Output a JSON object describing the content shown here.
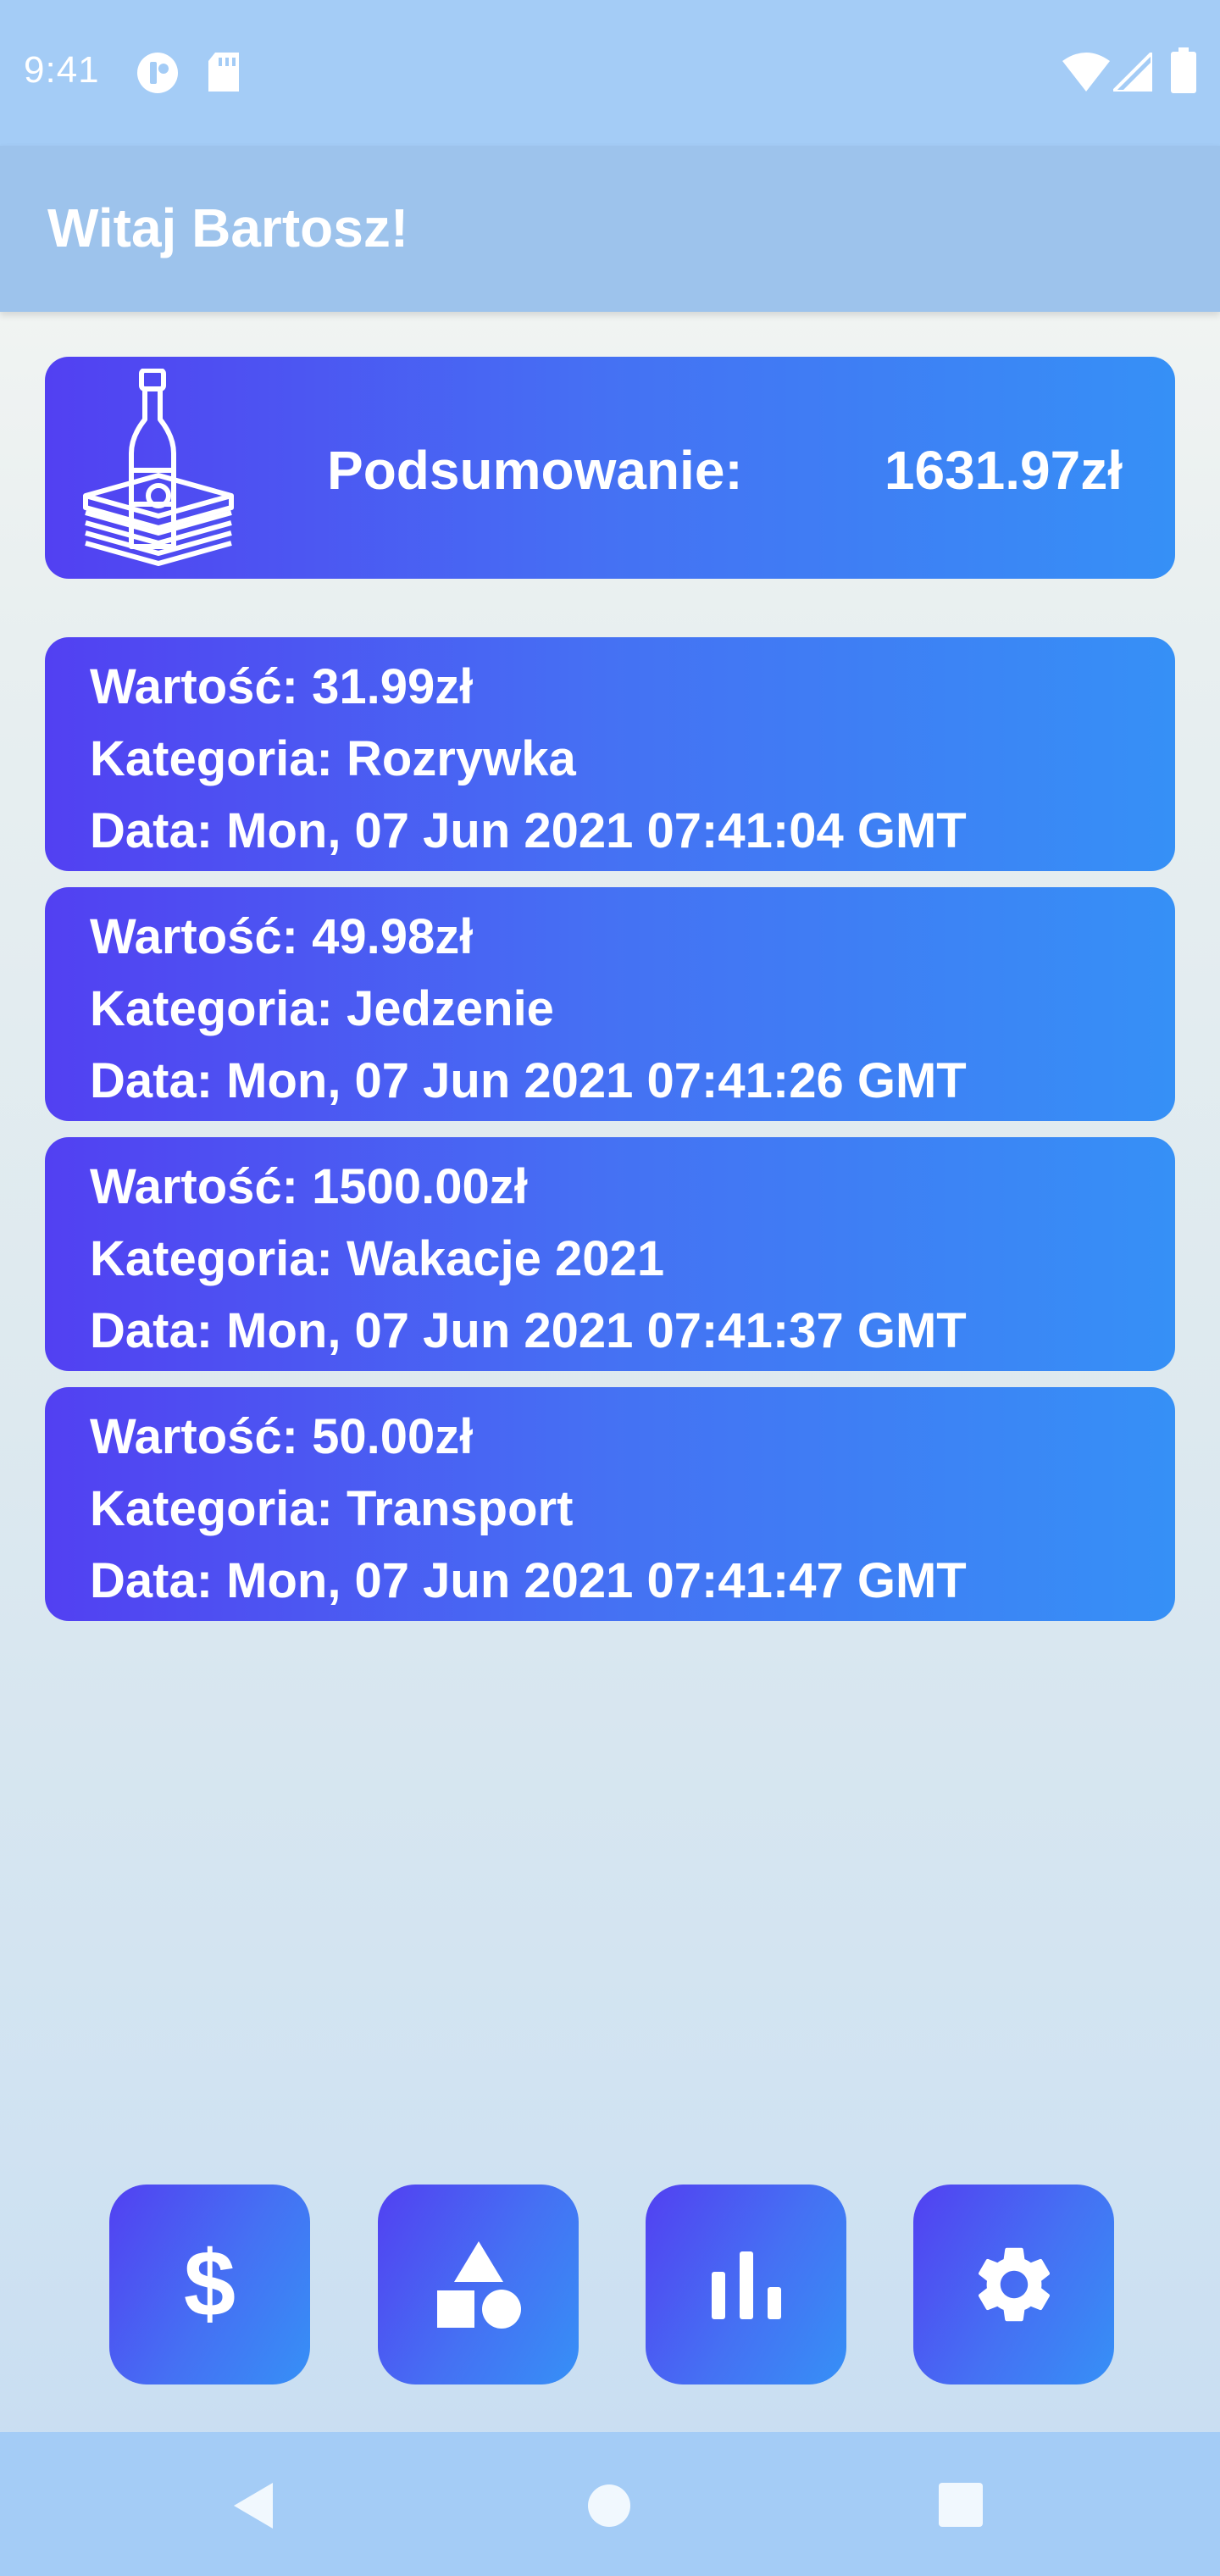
{
  "status_bar": {
    "time": "9:41",
    "left_icons": [
      "notification-icon",
      "sd-card-icon"
    ],
    "right_icons": [
      "wifi-icon",
      "signal-icon",
      "battery-icon"
    ]
  },
  "app_bar": {
    "title": "Witaj Bartosz!"
  },
  "summary": {
    "icon": "money-bottle-icon",
    "label": "Podsumowanie:",
    "total": "1631.97zł"
  },
  "expenses": [
    {
      "value": "Wartość: 31.99zł",
      "category": "Kategoria: Rozrywka",
      "date": "Data: Mon, 07 Jun 2021 07:41:04 GMT"
    },
    {
      "value": "Wartość: 49.98zł",
      "category": "Kategoria: Jedzenie",
      "date": "Data: Mon, 07 Jun 2021 07:41:26 GMT"
    },
    {
      "value": "Wartość: 1500.00zł",
      "category": "Kategoria: Wakacje 2021",
      "date": "Data: Mon, 07 Jun 2021 07:41:37 GMT"
    },
    {
      "value": "Wartość: 50.00zł",
      "category": "Kategoria: Transport",
      "date": "Data: Mon, 07 Jun 2021 07:41:47 GMT"
    }
  ],
  "bottom_nav": {
    "buttons": [
      {
        "icon": "dollar-icon",
        "glyph": "$"
      },
      {
        "icon": "shapes-icon"
      },
      {
        "icon": "bar-chart-icon"
      },
      {
        "icon": "gear-icon"
      }
    ]
  },
  "system_nav": {
    "buttons": [
      "back-icon",
      "home-icon",
      "recents-icon"
    ]
  },
  "colors": {
    "card_gradient_start": "#5240f2",
    "card_gradient_end": "#3690f6",
    "status_bar": "#a4ccf6",
    "app_bar": "#9dc3ec",
    "text": "#ffffff"
  }
}
